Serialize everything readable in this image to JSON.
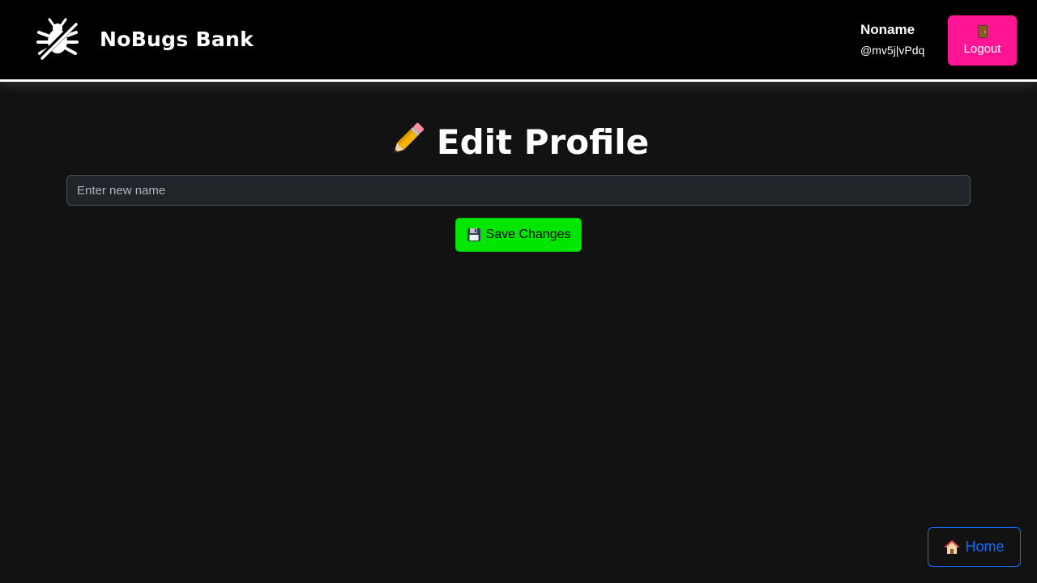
{
  "header": {
    "brand": "NoBugs Bank",
    "logo_icon": "bug-slash-icon",
    "user": {
      "name": "Noname",
      "handle": "@mv5j|vPdq"
    },
    "logout": {
      "icon": "door-icon",
      "label": "Logout"
    }
  },
  "main": {
    "title_icon": "pencil-icon",
    "title": "Edit Profile",
    "name_input": {
      "placeholder": "Enter new name",
      "value": ""
    },
    "save_button": {
      "icon": "floppy-disk-icon",
      "label": "Save Changes"
    }
  },
  "footer": {
    "home_button": {
      "icon": "house-icon",
      "label": "Home"
    }
  },
  "colors": {
    "background": "#121212",
    "header_bg": "#000000",
    "logout_bg": "#ff1493",
    "save_bg": "#00e600",
    "home_border": "#0d6efd",
    "input_bg": "#212529"
  }
}
